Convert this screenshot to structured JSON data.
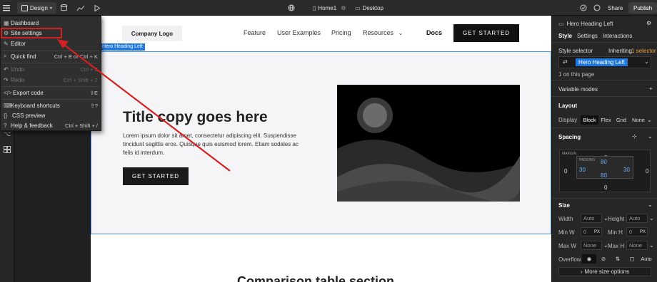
{
  "topbar": {
    "design_label": "Design",
    "home_label": "Home1",
    "device_label": "Desktop",
    "share_label": "Share",
    "publish_label": "Publish"
  },
  "menu": {
    "items": [
      {
        "label": "Dashboard",
        "shortcut": "",
        "icon": "grid-icon",
        "disabled": false
      },
      {
        "label": "Site settings",
        "shortcut": "",
        "icon": "gear-icon",
        "disabled": false
      },
      {
        "label": "Editor",
        "shortcut": "",
        "icon": "pencil-icon",
        "disabled": false
      },
      {
        "label": "Quick find",
        "shortcut": "Ctrl + E or Ctrl + K",
        "icon": "search-icon",
        "disabled": false
      },
      {
        "label": "Undo",
        "shortcut": "Ctrl + Z",
        "icon": "undo-icon",
        "disabled": true
      },
      {
        "label": "Redo",
        "shortcut": "Ctrl + Shift + Z",
        "icon": "redo-icon",
        "disabled": true
      },
      {
        "label": "Export code",
        "shortcut": "⇧E",
        "icon": "code-icon",
        "disabled": false
      },
      {
        "label": "Keyboard shortcuts",
        "shortcut": "⇧?",
        "icon": "keyboard-icon",
        "disabled": false
      },
      {
        "label": "CSS preview",
        "shortcut": "",
        "icon": "braces-icon",
        "disabled": false
      },
      {
        "label": "Help & feedback",
        "shortcut": "Ctrl + Shift + /",
        "icon": "help-icon",
        "disabled": false
      }
    ]
  },
  "canvas": {
    "logo": "Company Logo",
    "nav_links": [
      "Feature",
      "User Examples",
      "Pricing",
      "Resources"
    ],
    "docs": "Docs",
    "nav_cta": "GET STARTED",
    "hero_tag": "Hero Heading Left",
    "hero_title": "Title copy goes here",
    "hero_body": "Lorem ipsum dolor sit amet, consectetur adipiscing elit. Suspendisse tincidunt sagittis eros. Quisque quis euismod lorem. Etiam sodales ac felis id interdum.",
    "hero_cta": "GET STARTED",
    "section_title": "Comparison table section"
  },
  "right": {
    "element_name": "Hero Heading Left",
    "tabs": [
      "Style",
      "Settings",
      "Interactions"
    ],
    "style_selector_label": "Style selector",
    "inheriting_label": "Inheriting",
    "inheriting_count": "1 selector",
    "selector_chip": "Hero Heading Left",
    "on_page": "1 on this page",
    "variable_modes": "Variable modes",
    "layout_title": "Layout",
    "display_label": "Display",
    "display_options": [
      "Block",
      "Flex",
      "Grid",
      "None"
    ],
    "spacing_title": "Spacing",
    "margin_label": "MARGIN",
    "padding_label": "PADDING",
    "margin": {
      "top": "0",
      "right": "0",
      "bottom": "0",
      "left": "0"
    },
    "padding": {
      "top": "80",
      "right": "30",
      "bottom": "80",
      "left": "30"
    },
    "size_title": "Size",
    "width_label": "Width",
    "width_value": "Auto",
    "height_label": "Height",
    "height_value": "Auto",
    "minw_label": "Min W",
    "minw_value": "0",
    "minw_unit": "PX",
    "minh_label": "Min H",
    "minh_value": "0",
    "minh_unit": "PX",
    "maxw_label": "Max W",
    "maxw_value": "None",
    "maxh_label": "Max H",
    "maxh_value": "None",
    "overflow_label": "Overflow",
    "overflow_value": "Auto",
    "more_size": "More size options"
  },
  "colors": {
    "accent": "#1f78e0",
    "annotation": "#d42020"
  }
}
